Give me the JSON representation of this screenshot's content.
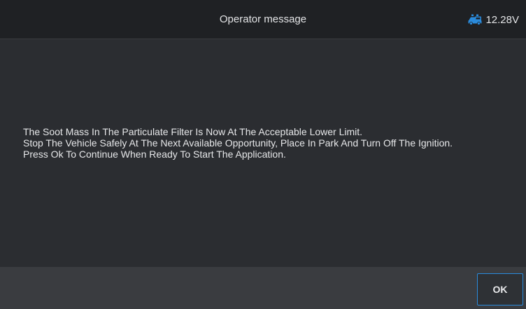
{
  "header": {
    "title": "Operator message",
    "battery_icon": "car-battery-icon",
    "voltage": "12.28V",
    "accent_color": "#2a8bdc"
  },
  "message": {
    "lines": [
      "The Soot Mass In The Particulate Filter Is Now At The Acceptable Lower Limit.",
      "Stop The Vehicle Safely At The Next Available Opportunity, Place In Park And Turn Off The Ignition.",
      "Press Ok To Continue When Ready To Start The Application."
    ]
  },
  "footer": {
    "ok_label": "OK"
  }
}
